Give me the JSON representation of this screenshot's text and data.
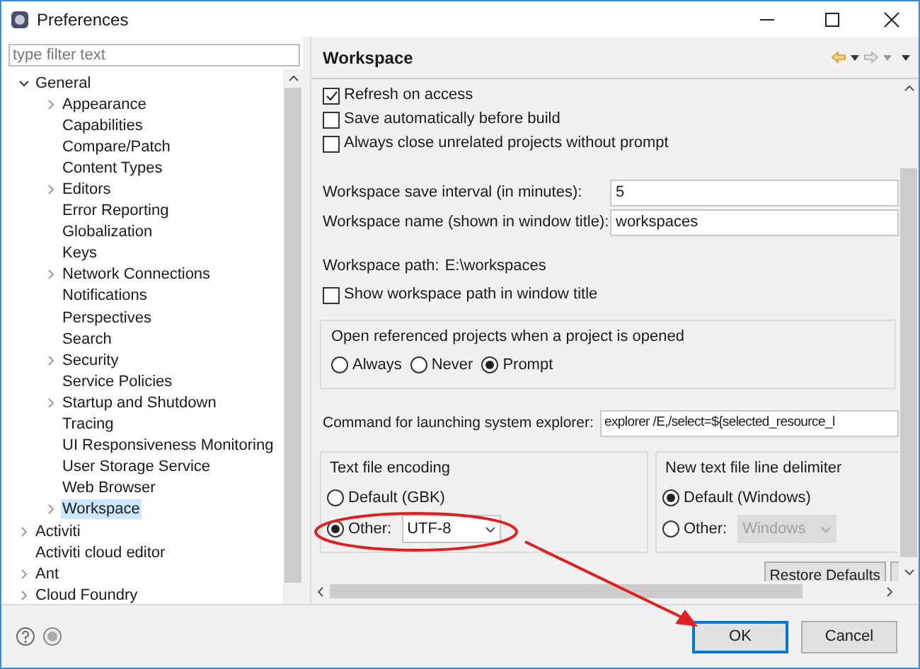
{
  "window": {
    "title": "Preferences"
  },
  "filter": {
    "placeholder": "type filter text"
  },
  "tree": [
    {
      "label": "General",
      "kind": "branch",
      "expanded": true,
      "selected": false,
      "children": [
        {
          "label": "Appearance",
          "kind": "branch",
          "expanded": false,
          "selected": false
        },
        {
          "label": "Capabilities",
          "kind": "leaf",
          "selected": false
        },
        {
          "label": "Compare/Patch",
          "kind": "leaf",
          "selected": false
        },
        {
          "label": "Content Types",
          "kind": "leaf",
          "selected": false
        },
        {
          "label": "Editors",
          "kind": "branch",
          "expanded": false,
          "selected": false
        },
        {
          "label": "Error Reporting",
          "kind": "leaf",
          "selected": false
        },
        {
          "label": "Globalization",
          "kind": "leaf",
          "selected": false
        },
        {
          "label": "Keys",
          "kind": "leaf",
          "selected": false
        },
        {
          "label": "Network Connections",
          "kind": "branch",
          "expanded": false,
          "selected": false
        },
        {
          "label": "Notifications",
          "kind": "leaf",
          "selected": false
        },
        {
          "label": "Perspectives",
          "kind": "leaf",
          "selected": false
        },
        {
          "label": "Search",
          "kind": "leaf",
          "selected": false
        },
        {
          "label": "Security",
          "kind": "branch",
          "expanded": false,
          "selected": false
        },
        {
          "label": "Service Policies",
          "kind": "leaf",
          "selected": false
        },
        {
          "label": "Startup and Shutdown",
          "kind": "branch",
          "expanded": false,
          "selected": false
        },
        {
          "label": "Tracing",
          "kind": "leaf",
          "selected": false
        },
        {
          "label": "UI Responsiveness Monitoring",
          "kind": "leaf",
          "selected": false
        },
        {
          "label": "User Storage Service",
          "kind": "leaf",
          "selected": false
        },
        {
          "label": "Web Browser",
          "kind": "leaf",
          "selected": false
        },
        {
          "label": "Workspace",
          "kind": "branch",
          "expanded": false,
          "selected": true
        }
      ]
    },
    {
      "label": "Activiti",
      "kind": "branch",
      "expanded": false,
      "selected": false
    },
    {
      "label": "Activiti cloud editor",
      "kind": "leaf",
      "selected": false
    },
    {
      "label": "Ant",
      "kind": "branch",
      "expanded": false,
      "selected": false
    },
    {
      "label": "Cloud Foundry",
      "kind": "branch",
      "expanded": false,
      "selected": false
    }
  ],
  "page": {
    "title": "Workspace",
    "checks_top": [
      {
        "label": "Refresh on access",
        "checked": true
      },
      {
        "label": "Save automatically before build",
        "checked": false
      },
      {
        "label": "Always close unrelated projects without prompt",
        "checked": false
      }
    ],
    "save_interval": {
      "label": "Workspace save interval (in minutes):",
      "value": "5"
    },
    "workspace_name": {
      "label": "Workspace name (shown in window title):",
      "value": "workspaces"
    },
    "workspace_path": {
      "label": "Workspace path:",
      "value": "E:\\workspaces"
    },
    "show_path": {
      "label": "Show workspace path in window title",
      "checked": false
    },
    "open_projects": {
      "label": "Open referenced projects when a project is opened",
      "options": [
        {
          "label": "Always",
          "selected": false
        },
        {
          "label": "Never",
          "selected": false
        },
        {
          "label": "Prompt",
          "selected": true
        }
      ]
    },
    "explorer_command": {
      "label": "Command for launching system explorer:",
      "value": "explorer /E,/select=${selected_resource_l"
    },
    "encoding": {
      "label": "Text file encoding",
      "default": {
        "label": "Default (GBK)",
        "selected": false
      },
      "other": {
        "label": "Other:",
        "selected": true,
        "value": "UTF-8",
        "disabled": false
      }
    },
    "delimiter": {
      "label": "New text file line delimiter",
      "default": {
        "label": "Default (Windows)",
        "selected": true
      },
      "other": {
        "label": "Other:",
        "selected": false,
        "value": "Windows",
        "disabled": true
      }
    },
    "restore_button": "Restore Defaults"
  },
  "buttons": [
    "OK",
    "Cancel"
  ]
}
